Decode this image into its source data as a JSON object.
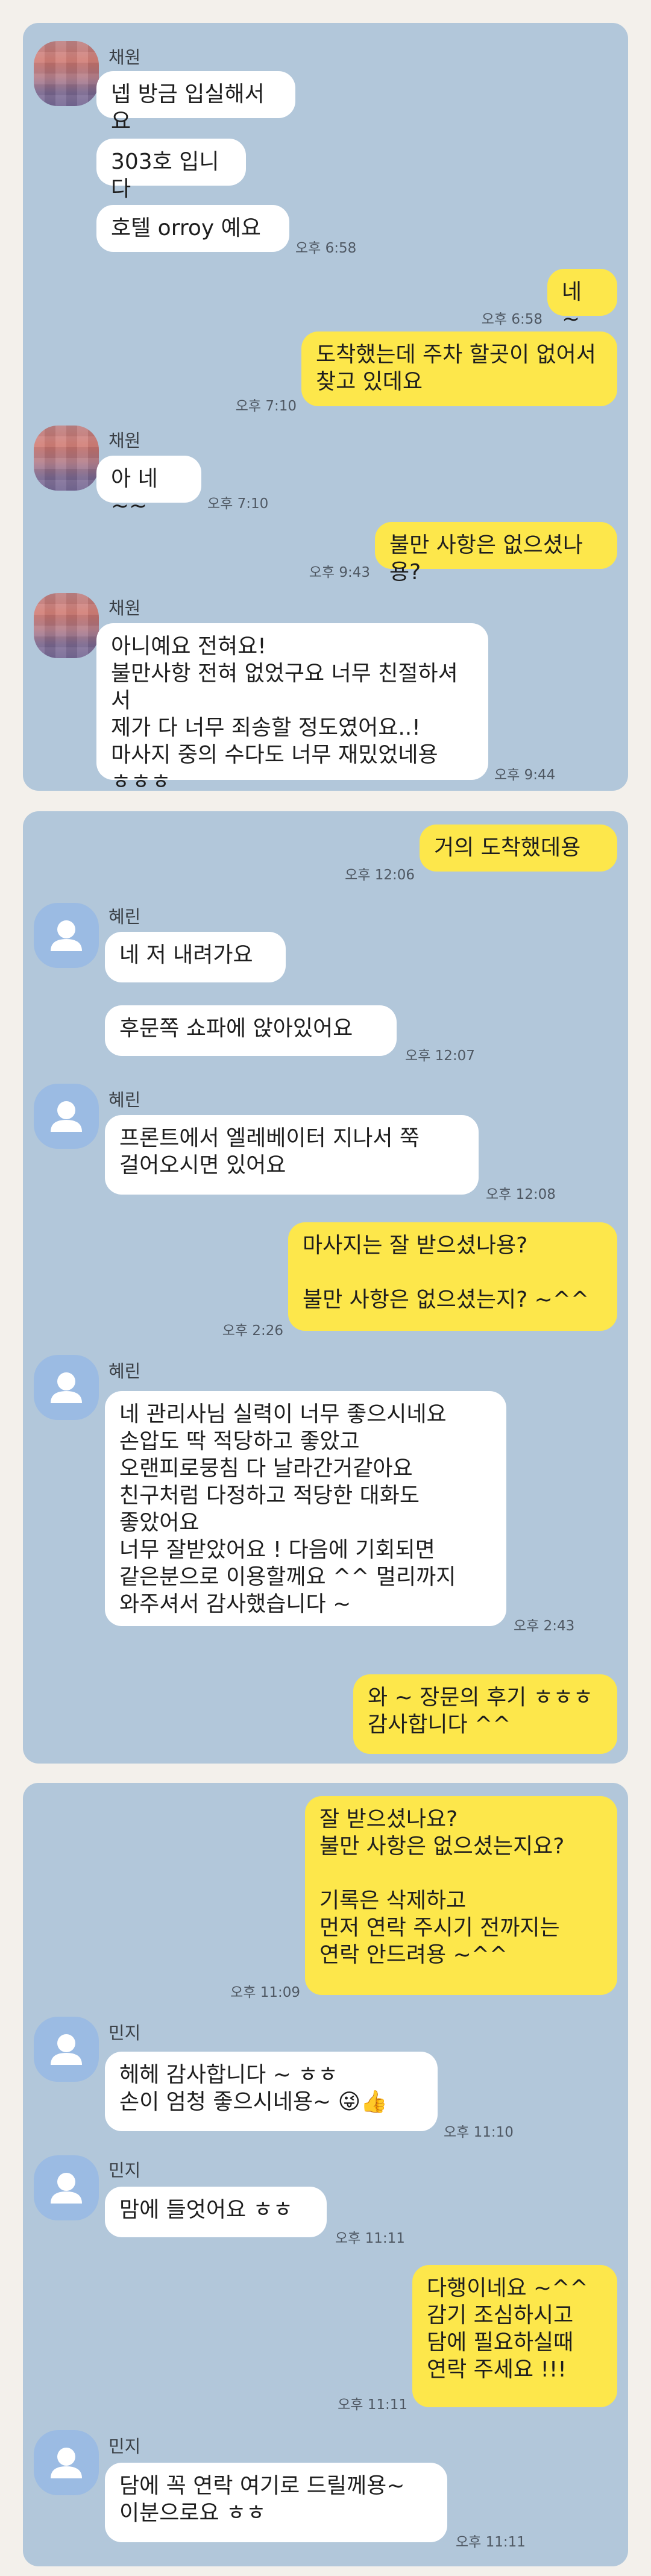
{
  "chat1": {
    "sender1": "채원",
    "m1": "넵 방금 입실해서요",
    "m2": "303호 입니다",
    "m3": "호텔 orroy 예요",
    "t3": "오후 6:58",
    "o1": "네 ~",
    "ot1": "오후 6:58",
    "o2": "도착했는데  주차 할곳이 없어서\n찾고 있데요",
    "ot2": "오후 7:10",
    "sender2": "채원",
    "m4": "아 네~~",
    "t4": "오후 7:10",
    "o3": "불만 사항은 없으셨나용?",
    "ot3": "오후 9:43",
    "sender3": "채원",
    "m5": "아니예요 전혀요!\n불만사항 전혀 없었구요 너무 친절하셔서\n제가 다 너무 죄송할 정도였어요..!\n마사지 중의 수다도 너무 재밌었네용\nㅎㅎㅎ",
    "t5": "오후 9:44"
  },
  "chat2": {
    "o1": "거의 도착했데용",
    "ot1": "오후 12:06",
    "sender1": "혜린",
    "m1": "네 저 내려가요",
    "m2": "후문쪽 쇼파에 앉아있어요",
    "t2": "오후 12:07",
    "sender2": "혜린",
    "m3": "프론트에서 엘레베이터 지나서 쭉\n걸어오시면 있어요",
    "t3": "오후 12:08",
    "o2": "마사지는 잘 받으셨나용?\n\n불만 사항은 없으셨는지? ~^^",
    "ot2": "오후 2:26",
    "sender3": "혜린",
    "m4": "네 관리사님 실력이 너무 좋으시네요\n손압도 딱 적당하고 좋았고\n오랜피로뭉침 다 날라간거같아요\n친구처럼 다정하고 적당한 대화도\n좋았어요\n너무 잘받았어요 ! 다음에 기회되면\n같은분으로 이용할께요 ^^ 멀리까지\n와주셔서 감사했습니다 ~",
    "t4": "오후 2:43",
    "o3": "와 ~ 장문의 후기 ㅎㅎㅎ\n감사합니다 ^^"
  },
  "chat3": {
    "o1": "잘 받으셨나요?\n불만 사항은 없으셨는지요?\n\n기록은 삭제하고\n먼저 연락 주시기 전까지는\n연락 안드려용 ~^^",
    "ot1": "오후 11:09",
    "sender1": "민지",
    "m1": "헤헤 감사합니다 ~ ㅎㅎ\n손이 엄청 좋으시네용~ 😜👍",
    "t1": "오후 11:10",
    "sender2": "민지",
    "m2": "맘에 들엇어요 ㅎㅎ",
    "t2": "오후 11:11",
    "o2": "다행이네요 ~^^\n감기 조심하시고\n담에 필요하실때\n연락 주세요 !!!",
    "ot2": "오후 11:11",
    "sender3": "민지",
    "m3": "담에 꼭 연락 여기로 드릴께용~\n이분으로요 ㅎㅎ",
    "t3": "오후 11:11"
  }
}
